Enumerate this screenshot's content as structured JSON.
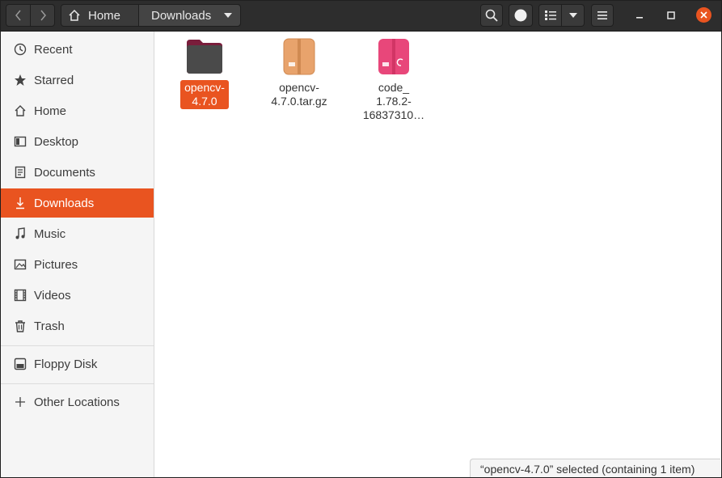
{
  "header": {
    "path": {
      "home_label": "Home",
      "current_label": "Downloads"
    }
  },
  "sidebar": {
    "items": [
      {
        "label": "Recent",
        "icon": "clock-icon"
      },
      {
        "label": "Starred",
        "icon": "star-icon"
      },
      {
        "label": "Home",
        "icon": "home-icon"
      },
      {
        "label": "Desktop",
        "icon": "desktop-icon"
      },
      {
        "label": "Documents",
        "icon": "document-icon"
      },
      {
        "label": "Downloads",
        "icon": "download-icon",
        "active": true
      },
      {
        "label": "Music",
        "icon": "music-icon"
      },
      {
        "label": "Pictures",
        "icon": "picture-icon"
      },
      {
        "label": "Videos",
        "icon": "video-icon"
      },
      {
        "label": "Trash",
        "icon": "trash-icon"
      }
    ],
    "devices": [
      {
        "label": "Floppy Disk",
        "icon": "floppy-icon"
      }
    ],
    "other": [
      {
        "label": "Other Locations",
        "icon": "plus-icon"
      }
    ]
  },
  "files": [
    {
      "name_line1": "opencv-",
      "name_line2": "4.7.0",
      "name_line3": "",
      "type": "folder",
      "selected": true
    },
    {
      "name_line1": "opencv-",
      "name_line2": "4.7.0.tar.gz",
      "name_line3": "",
      "type": "archive"
    },
    {
      "name_line1": "code_",
      "name_line2": "1.78.2-",
      "name_line3": "16837310…",
      "type": "debian-package"
    }
  ],
  "status": {
    "text": "“opencv-4.7.0” selected (containing 1 item)"
  },
  "colors": {
    "accent": "#e95420",
    "header": "#2d2d2d",
    "sidebar": "#f5f5f5"
  }
}
